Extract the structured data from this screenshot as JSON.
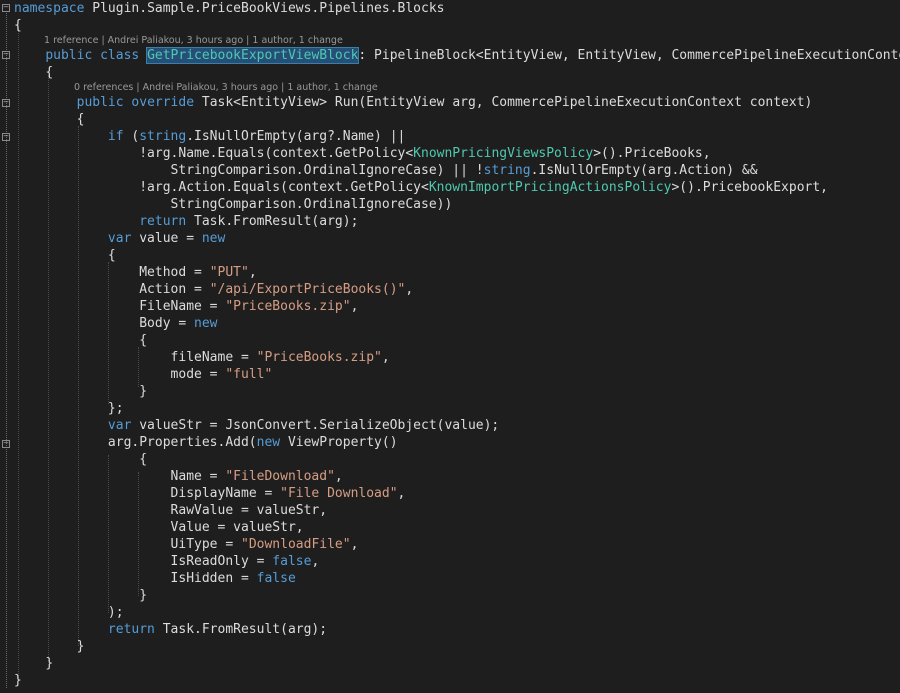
{
  "code": {
    "l1": {
      "kw": "namespace",
      "name": " Plugin.Sample.PriceBookViews.Pipelines.Blocks"
    },
    "l2": {
      "t": "{"
    },
    "lens1": {
      "text": "1 reference | Andrei Paliakou, 3 hours ago | 1 author, 1 change"
    },
    "l3": {
      "kw1": "public",
      "kw2": " class ",
      "cls": "GetPricebookExportViewBlock",
      "rest": ": PipelineBlock<EntityView, EntityView, CommercePipelineExecutionContext>"
    },
    "l4": {
      "t": "{"
    },
    "lens2": {
      "text": "0 references | Andrei Paliakou, 3 hours ago | 1 author, 1 change"
    },
    "l5": {
      "kw1": "public",
      "kw2": " override",
      "rest": " Task<EntityView> Run(EntityView arg, CommercePipelineExecutionContext context)"
    },
    "l6": {
      "t": "{"
    },
    "l7": {
      "kw": "if",
      "a": " (",
      "kw2": "string",
      "b": ".IsNullOrEmpty(arg?.Name) ||"
    },
    "l8": {
      "a": "!arg.Name.Equals(context.GetPolicy<",
      "ty": "KnownPricingViewsPolicy",
      "b": ">().PriceBooks,"
    },
    "l9": {
      "a": "StringComparison.OrdinalIgnoreCase) || !",
      "kw": "string",
      "b": ".IsNullOrEmpty(arg.Action) &&"
    },
    "l10": {
      "a": "!arg.Action.Equals(context.GetPolicy<",
      "ty": "KnownImportPricingActionsPolicy",
      "b": ">().PricebookExport,"
    },
    "l11": {
      "t": "StringComparison.OrdinalIgnoreCase))"
    },
    "l12": {
      "kw": "return",
      "b": " Task.FromResult(arg);"
    },
    "l13": {
      "kw": "var",
      "a": " value = ",
      "kw2": "new"
    },
    "l14": {
      "t": "{"
    },
    "l15": {
      "a": "Method = ",
      "str": "\"PUT\"",
      "b": ","
    },
    "l16": {
      "a": "Action = ",
      "str": "\"/api/ExportPriceBooks()\"",
      "b": ","
    },
    "l17": {
      "a": "FileName = ",
      "str": "\"PriceBooks.zip\"",
      "b": ","
    },
    "l18": {
      "a": "Body = ",
      "kw": "new"
    },
    "l19": {
      "t": "{"
    },
    "l20": {
      "a": "fileName = ",
      "str": "\"PriceBooks.zip\"",
      "b": ","
    },
    "l21": {
      "a": "mode = ",
      "str": "\"full\""
    },
    "l22": {
      "t": "}"
    },
    "l23": {
      "t": "};"
    },
    "l24": {
      "kw": "var",
      "b": " valueStr = JsonConvert.SerializeObject(value);"
    },
    "l25": {
      "a": "arg.Properties.Add(",
      "kw": "new",
      "b": " ViewProperty()"
    },
    "l26": {
      "t": "{"
    },
    "l27": {
      "a": "Name = ",
      "str": "\"FileDownload\"",
      "b": ","
    },
    "l28": {
      "a": "DisplayName = ",
      "str": "\"File Download\"",
      "b": ","
    },
    "l29": {
      "t": "RawValue = valueStr,"
    },
    "l30": {
      "t": "Value = valueStr,"
    },
    "l31": {
      "a": "UiType = ",
      "str": "\"DownloadFile\"",
      "b": ","
    },
    "l32": {
      "a": "IsReadOnly = ",
      "kw": "false",
      "b": ","
    },
    "l33": {
      "a": "IsHidden = ",
      "kw": "false"
    },
    "l34": {
      "t": "}"
    },
    "l35": {
      "t": ");"
    },
    "l36": {
      "kw": "return",
      "b": " Task.FromResult(arg);"
    },
    "l37": {
      "t": "}"
    },
    "l38": {
      "t": "}"
    },
    "l39": {
      "t": "}"
    }
  },
  "colors": {
    "background": "#1e1e1e",
    "keyword": "#569cd6",
    "type": "#4ec9b0",
    "string": "#d69d85",
    "text": "#dcdcdc",
    "codelens": "#999999",
    "selection": "#264f78"
  },
  "icons": {
    "fold": "collapse-minus-icon"
  }
}
